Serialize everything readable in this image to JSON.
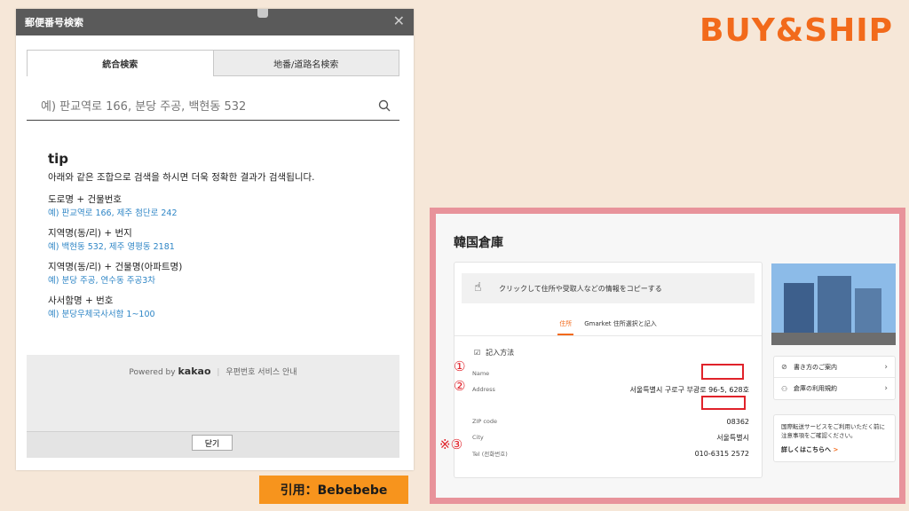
{
  "popup": {
    "title": "郵便番号検索",
    "close_glyph": "✕",
    "tabs": [
      {
        "label": "統合検索"
      },
      {
        "label": "地番/道路名検索"
      }
    ],
    "search_placeholder": "예) 판교역로 166, 분당 주공, 백현동 532",
    "tip_title": "tip",
    "tip_desc": "아래와 같은 조합으로 검색을 하시면 더욱 정확한 결과가 검색됩니다.",
    "tips": [
      {
        "label": "도로명 + 건물번호",
        "example": "예) 판교역로 166,  제주 첨단로 242"
      },
      {
        "label": "지역명(동/리) + 번지",
        "example": "예) 백현동 532,  제주 영평동 2181"
      },
      {
        "label": "지역명(동/리) + 건물명(아파트명)",
        "example": "예) 분당 주공,  연수동 주공3차"
      },
      {
        "label": "사서함명 + 번호",
        "example": "예) 분당우체국사서함 1~100"
      }
    ],
    "powered_by": "Powered by",
    "powered_brand": "kakao",
    "powered_sep": "|",
    "postal_info": "우편번호 서비스 안내",
    "close_button": "닫기"
  },
  "logo": "BUY&SHIP",
  "warehouse": {
    "title": "韓国倉庫",
    "copy_hint": "クリックして住所や受取人などの情報をコピーする",
    "tabs": [
      {
        "label": "住所",
        "active": true
      },
      {
        "label": "Gmarket 住所選択と記入",
        "active": false
      }
    ],
    "howto": "記入方法",
    "fields": [
      {
        "key": "Name",
        "value": ""
      },
      {
        "key": "Address",
        "value": "서울특별시 구로구 부광로 96-5, 628호"
      },
      {
        "key": "",
        "value": ""
      },
      {
        "key": "ZIP code",
        "value": "08362"
      },
      {
        "key": "City",
        "value": "서울특별시"
      },
      {
        "key": "Tel (전화번호)",
        "value": "010-6315 2572"
      }
    ],
    "markers": [
      "①",
      "②",
      "※③"
    ],
    "side_buttons": [
      {
        "label": "書き方のご案内",
        "icon": "guide-icon"
      },
      {
        "label": "倉庫の利用規約",
        "icon": "user-icon"
      }
    ],
    "notice": "国際転送サービスをご利用いただく前に注意事項をご確認ください。",
    "notice_link": "詳しくはこちらへ",
    "notice_arrow": ">"
  },
  "citation": "引用：Bebebebe",
  "colors": {
    "accent": "#f26a1b",
    "frame": "#e8939b",
    "marker": "#e0222a",
    "link": "#2f86c6"
  }
}
